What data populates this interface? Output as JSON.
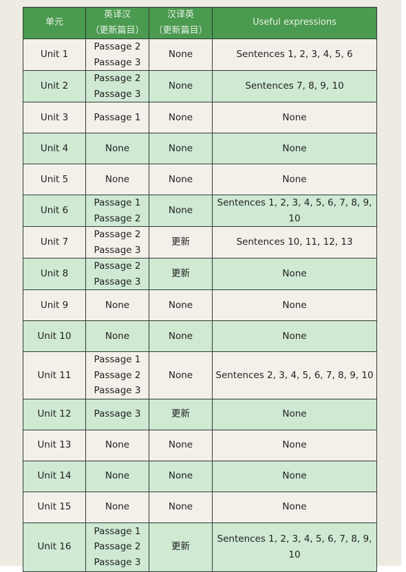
{
  "table": {
    "headers": [
      {
        "lines": [
          "单元"
        ]
      },
      {
        "lines": [
          "英译汉",
          "（更新篇目）"
        ]
      },
      {
        "lines": [
          "汉译英",
          "（更新篇目）"
        ]
      },
      {
        "lines": [
          "Useful expressions"
        ]
      }
    ],
    "rows": [
      {
        "unit": "Unit 1",
        "en_zh": [
          "Passage 2",
          "Passage 3"
        ],
        "zh_en": "None",
        "useful": "Sentences 1, 2, 3, 4, 5, 6"
      },
      {
        "unit": "Unit 2",
        "en_zh": [
          "Passage 2",
          "Passage 3"
        ],
        "zh_en": "None",
        "useful": "Sentences 7, 8, 9, 10"
      },
      {
        "unit": "Unit 3",
        "en_zh": [
          "Passage 1"
        ],
        "zh_en": "None",
        "useful": "None"
      },
      {
        "unit": "Unit 4",
        "en_zh": [
          "None"
        ],
        "zh_en": "None",
        "useful": "None"
      },
      {
        "unit": "Unit 5",
        "en_zh": [
          "None"
        ],
        "zh_en": "None",
        "useful": "None"
      },
      {
        "unit": "Unit 6",
        "en_zh": [
          "Passage 1",
          "Passage 2"
        ],
        "zh_en": "None",
        "useful": "Sentences 1, 2, 3, 4, 5, 6, 7, 8, 9, 10"
      },
      {
        "unit": "Unit 7",
        "en_zh": [
          "Passage 2",
          "Passage 3"
        ],
        "zh_en": "更新",
        "useful": "Sentences 10, 11, 12, 13"
      },
      {
        "unit": "Unit 8",
        "en_zh": [
          "Passage 2",
          "Passage 3"
        ],
        "zh_en": "更新",
        "useful": "None"
      },
      {
        "unit": "Unit 9",
        "en_zh": [
          "None"
        ],
        "zh_en": "None",
        "useful": "None"
      },
      {
        "unit": "Unit 10",
        "en_zh": [
          "None"
        ],
        "zh_en": "None",
        "useful": "None"
      },
      {
        "unit": "Unit 11",
        "en_zh": [
          "Passage 1",
          "Passage 2",
          "Passage 3"
        ],
        "zh_en": "None",
        "useful": "Sentences 2, 3, 4, 5, 6, 7, 8, 9, 10"
      },
      {
        "unit": "Unit 12",
        "en_zh": [
          "Passage 3"
        ],
        "zh_en": "更新",
        "useful": "None"
      },
      {
        "unit": "Unit 13",
        "en_zh": [
          "None"
        ],
        "zh_en": "None",
        "useful": "None"
      },
      {
        "unit": "Unit 14",
        "en_zh": [
          "None"
        ],
        "zh_en": "None",
        "useful": "None"
      },
      {
        "unit": "Unit 15",
        "en_zh": [
          "None"
        ],
        "zh_en": "None",
        "useful": "None"
      },
      {
        "unit": "Unit 16",
        "en_zh": [
          "Passage 1",
          "Passage 2",
          "Passage 3"
        ],
        "zh_en": "更新",
        "useful": "Sentences 1, 2, 3, 4, 5, 6, 7, 8, 9, 10"
      }
    ]
  },
  "colors": {
    "header": "#4a9a4f",
    "row_odd": "#f3f0ea",
    "row_even": "#cfe9d3",
    "page": "#eeebe3"
  }
}
